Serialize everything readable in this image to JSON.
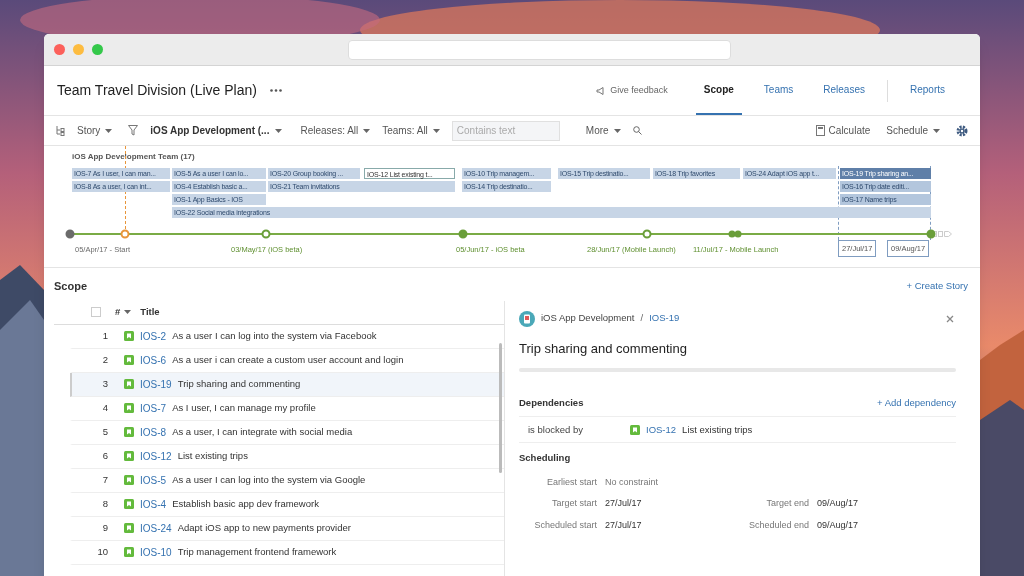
{
  "plan": {
    "title": "Team Travel Division (Live Plan)"
  },
  "nav": {
    "feedback": "Give feedback",
    "tabs": [
      {
        "label": "Scope",
        "selected": true
      },
      {
        "label": "Teams",
        "selected": false
      },
      {
        "label": "Releases",
        "selected": false
      },
      {
        "label": "Reports",
        "selected": false
      }
    ]
  },
  "toolbar": {
    "hierarchy": "Story",
    "filter": "iOS App Development (...",
    "releases": "Releases: All",
    "teams": "Teams: All",
    "search": {
      "placeholder": "Contains text"
    },
    "more": "More",
    "calculate": "Calculate",
    "schedule": "Schedule"
  },
  "timeline": {
    "team": "iOS App Development Team (17)",
    "bars": [
      {
        "label": "IOS-7 As I user, I can man...",
        "kind": "plain"
      },
      {
        "label": "IOS-8 As a user, I can int...",
        "kind": "plain"
      },
      {
        "label": "IOS-5 As a user I can lo...",
        "kind": "plain"
      },
      {
        "label": "IOS-4 Establish basic a...",
        "kind": "plain"
      },
      {
        "label": "IOS-1 App Basics - IOS",
        "kind": "plain"
      },
      {
        "label": "IOS-22 Social media integrations",
        "kind": "plain"
      },
      {
        "label": "IOS-20 Group booking ...",
        "kind": "plain"
      },
      {
        "label": "IOS-21 Team invitations",
        "kind": "plain"
      },
      {
        "label": "IOS-12 List existing t...",
        "kind": "selected"
      },
      {
        "label": "IOS-10 Trip managem...",
        "kind": "plain"
      },
      {
        "label": "IOS-14 Trip destinatio...",
        "kind": "plain"
      },
      {
        "label": "IOS-15 Trip destinatio...",
        "kind": "plain"
      },
      {
        "label": "IOS-18 Trip favorites",
        "kind": "plain"
      },
      {
        "label": "IOS-24 Adapt iOS app t...",
        "kind": "plain"
      },
      {
        "label": "IOS-19 Trip sharing an...",
        "kind": "current"
      },
      {
        "label": "IOS-16 Trip date editi...",
        "kind": "related"
      },
      {
        "label": "IOS-17 Name trips",
        "kind": "related"
      }
    ],
    "milestones": [
      {
        "kind": "filled",
        "color": "#6b6b6b"
      },
      {
        "kind": "hollow",
        "color": "#e8953a"
      },
      {
        "kind": "hollow",
        "color": "#6a9e3a"
      },
      {
        "kind": "filled",
        "color": "#6a9e3a"
      },
      {
        "kind": "hollow",
        "color": "#6a9e3a"
      },
      {
        "kind": "double",
        "color": "#6a9e3a"
      },
      {
        "kind": "filled",
        "color": "#6a9e3a"
      }
    ],
    "labels": [
      {
        "text": "05/Apr/17 - Start",
        "kind": "start"
      },
      {
        "text": "03/May/17 (iOS beta)",
        "kind": "release"
      },
      {
        "text": "05/Jun/17 - iOS beta",
        "kind": "release"
      },
      {
        "text": "28/Jun/17 (Mobile Launch)",
        "kind": "release"
      },
      {
        "text": "11/Jul/17 - Mobile Launch",
        "kind": "release"
      }
    ],
    "range": [
      "27/Jul/17",
      "09/Aug/17"
    ]
  },
  "scope": {
    "title": "Scope",
    "create": "+ Create Story",
    "select_all": {
      "checked": false
    },
    "columns": [
      "#",
      "Title"
    ],
    "rows": [
      {
        "num": "1",
        "key": "IOS-2",
        "title": "As a user I can log into the system via Facebook",
        "selected": false
      },
      {
        "num": "2",
        "key": "IOS-6",
        "title": "As a user i can create a custom user account and login",
        "selected": false
      },
      {
        "num": "3",
        "key": "IOS-19",
        "title": "Trip sharing and commenting",
        "selected": true
      },
      {
        "num": "4",
        "key": "IOS-7",
        "title": "As I user, I can manage my profile",
        "selected": false
      },
      {
        "num": "5",
        "key": "IOS-8",
        "title": "As a user, I can integrate with social media",
        "selected": false
      },
      {
        "num": "6",
        "key": "IOS-12",
        "title": "List existing trips",
        "selected": false
      },
      {
        "num": "7",
        "key": "IOS-5",
        "title": "As a user I can log into the system via Google",
        "selected": false
      },
      {
        "num": "8",
        "key": "IOS-4",
        "title": "Establish basic app dev framework",
        "selected": false
      },
      {
        "num": "9",
        "key": "IOS-24",
        "title": "Adapt iOS app to new payments provider",
        "selected": false
      },
      {
        "num": "10",
        "key": "IOS-10",
        "title": "Trip management frontend framework",
        "selected": false
      }
    ]
  },
  "detail": {
    "project": "iOS App Development",
    "separator": "/",
    "key": "IOS-19",
    "title": "Trip sharing and commenting",
    "dependencies": {
      "heading": "Dependencies",
      "add": "+ Add dependency",
      "items": [
        {
          "relation": "is blocked by",
          "key": "IOS-12",
          "title": "List existing trips"
        }
      ]
    },
    "scheduling": {
      "heading": "Scheduling",
      "earliest": {
        "label": "Earliest start",
        "value": "No constraint"
      },
      "fields": [
        [
          {
            "label": "Target start",
            "value": "27/Jul/17"
          },
          {
            "label": "Target end",
            "value": "09/Aug/17"
          }
        ],
        [
          {
            "label": "Scheduled start",
            "value": "27/Jul/17"
          },
          {
            "label": "Scheduled end",
            "value": "09/Aug/17"
          }
        ]
      ]
    }
  }
}
